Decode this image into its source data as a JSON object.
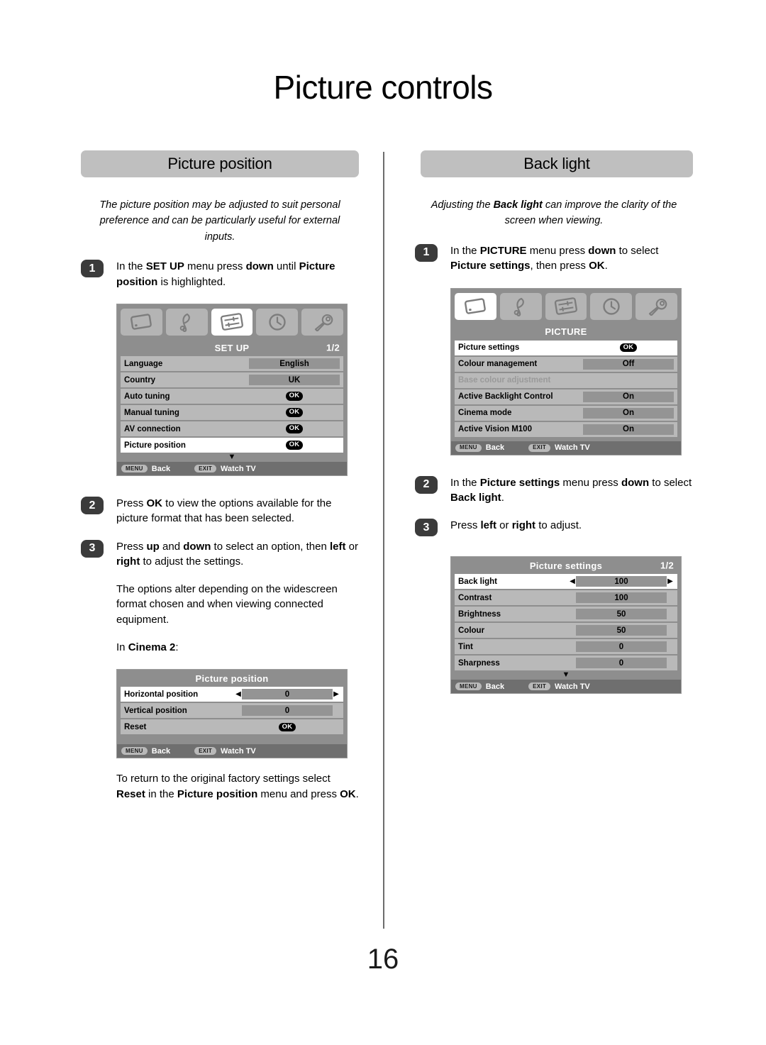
{
  "page": {
    "title": "Picture controls",
    "number": "16"
  },
  "left": {
    "section_title": "Picture position",
    "intro": {
      "part1": "The picture position may be adjusted to suit personal preference and can be particularly useful for external inputs."
    },
    "steps": [
      {
        "number": "1",
        "text_pre": "In the ",
        "bold1": "SET UP",
        "text_mid": " menu press ",
        "bold2": "down",
        "text_mid2": " until ",
        "bold3": "Picture position",
        "text_post": " is highlighted."
      },
      {
        "number": "2",
        "text_pre": "Press ",
        "bold1": "OK",
        "text_post": " to view the options available for the picture format that has been selected."
      },
      {
        "number": "3",
        "text_pre": "Press ",
        "bold1": "up",
        "text_mid": " and ",
        "bold2": "down",
        "text_mid2": " to select an option, then ",
        "bold3": "left",
        "text_mid3": " or ",
        "bold4": "right",
        "text_post": " to adjust the settings."
      }
    ],
    "note_options": "The options alter depending on the widescreen format chosen and when viewing connected equipment.",
    "cinema_label_pre": "In ",
    "cinema_label_bold": "Cinema 2",
    "cinema_label_post": ":",
    "reset_note": {
      "pre": "To return to the original factory settings select ",
      "bold1": "Reset",
      "mid": " in the ",
      "bold2": "Picture position",
      "mid2": " menu and press ",
      "bold3": "OK",
      "post": "."
    },
    "setup_menu": {
      "title": "SET UP",
      "page_indicator": "1/2",
      "icons": [
        "tv-screen-icon",
        "music-note-icon",
        "sliders-icon",
        "clock-icon",
        "wrench-icon"
      ],
      "active_icon_index": 2,
      "rows": [
        {
          "label": "Language",
          "value": "English",
          "type": "value",
          "selected": false
        },
        {
          "label": "Country",
          "value": "UK",
          "type": "value",
          "selected": false
        },
        {
          "label": "Auto tuning",
          "value": "OK",
          "type": "ok",
          "selected": false
        },
        {
          "label": "Manual tuning",
          "value": "OK",
          "type": "ok",
          "selected": false
        },
        {
          "label": "AV connection",
          "value": "OK",
          "type": "ok",
          "selected": false
        },
        {
          "label": "Picture position",
          "value": "OK",
          "type": "ok",
          "selected": true
        }
      ],
      "scroll_indicator": "▼",
      "footer": {
        "menu_key": "MENU",
        "menu_label": "Back",
        "exit_key": "EXIT",
        "exit_label": "Watch TV"
      }
    },
    "picture_position_menu": {
      "title": "Picture position",
      "page_indicator": "",
      "rows": [
        {
          "label": "Horizontal position",
          "value": "0",
          "type": "adjust",
          "selected": true
        },
        {
          "label": "Vertical position",
          "value": "0",
          "type": "value",
          "selected": false
        },
        {
          "label": "Reset",
          "value": "OK",
          "type": "ok",
          "selected": false
        }
      ],
      "footer": {
        "menu_key": "MENU",
        "menu_label": "Back",
        "exit_key": "EXIT",
        "exit_label": "Watch TV"
      }
    }
  },
  "right": {
    "section_title": "Back light",
    "intro": {
      "pre": "Adjusting the ",
      "bold": "Back light",
      "post": " can improve the clarity of the screen when viewing."
    },
    "steps": [
      {
        "number": "1",
        "text_pre": "In the ",
        "bold1": "PICTURE",
        "text_mid": " menu press ",
        "bold2": "down",
        "text_mid2": " to select ",
        "bold3": "Picture settings",
        "text_post": ", then press ",
        "bold4": "OK",
        "text_end": "."
      },
      {
        "number": "2",
        "text_pre": "In the ",
        "bold1": "Picture settings",
        "text_mid": " menu press ",
        "bold2": "down",
        "text_mid2": " to select ",
        "bold3": "Back light",
        "text_post": "."
      },
      {
        "number": "3",
        "text_pre": "Press ",
        "bold1": "left",
        "text_mid": " or ",
        "bold2": "right",
        "text_post": " to adjust."
      }
    ],
    "picture_menu": {
      "title": "PICTURE",
      "page_indicator": "",
      "icons": [
        "tv-screen-icon",
        "music-note-icon",
        "sliders-icon",
        "clock-icon",
        "wrench-icon"
      ],
      "active_icon_index": 0,
      "rows": [
        {
          "label": "Picture settings",
          "value": "OK",
          "type": "ok",
          "selected": true
        },
        {
          "label": "Colour management",
          "value": "Off",
          "type": "value",
          "selected": false
        },
        {
          "label": "Base colour adjustment",
          "value": "",
          "type": "none",
          "selected": false,
          "disabled": true
        },
        {
          "label": "Active Backlight Control",
          "value": "On",
          "type": "value",
          "selected": false
        },
        {
          "label": "Cinema mode",
          "value": "On",
          "type": "value",
          "selected": false
        },
        {
          "label": "Active Vision M100",
          "value": "On",
          "type": "value",
          "selected": false
        }
      ],
      "footer": {
        "menu_key": "MENU",
        "menu_label": "Back",
        "exit_key": "EXIT",
        "exit_label": "Watch TV"
      }
    },
    "picture_settings_menu": {
      "title": "Picture settings",
      "page_indicator": "1/2",
      "rows": [
        {
          "label": "Back light",
          "value": "100",
          "type": "adjust",
          "selected": true
        },
        {
          "label": "Contrast",
          "value": "100",
          "type": "value",
          "selected": false
        },
        {
          "label": "Brightness",
          "value": "50",
          "type": "value",
          "selected": false
        },
        {
          "label": "Colour",
          "value": "50",
          "type": "value",
          "selected": false
        },
        {
          "label": "Tint",
          "value": "0",
          "type": "value",
          "selected": false
        },
        {
          "label": "Sharpness",
          "value": "0",
          "type": "value",
          "selected": false
        }
      ],
      "scroll_indicator": "▼",
      "footer": {
        "menu_key": "MENU",
        "menu_label": "Back",
        "exit_key": "EXIT",
        "exit_label": "Watch TV"
      }
    }
  },
  "colors": {
    "pill_bg": "#bfbfbf",
    "osd_bg": "#8e8e8e",
    "osd_row": "#b9b9b9",
    "osd_row_selected": "#ffffff",
    "osd_value": "#949494",
    "osd_footer": "#6f6f6f",
    "badge": "#3b3b3b"
  }
}
